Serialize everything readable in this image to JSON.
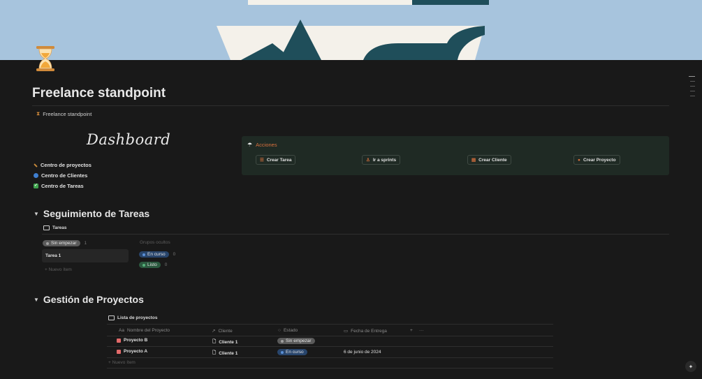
{
  "page": {
    "title": "Freelance standpoint",
    "breadcrumb": "Freelance standpoint",
    "dashboard_heading": "Dashboard"
  },
  "nav_links": [
    {
      "label": "Centro de proyectos",
      "icon": "hammer-icon",
      "color": "#c88a3a"
    },
    {
      "label": "Centro de Clientes",
      "icon": "people-icon",
      "color": "#3f7fd0"
    },
    {
      "label": "Centro de Tareas",
      "icon": "check-icon",
      "color": "#3fa34d"
    }
  ],
  "actions": {
    "title": "Acciones",
    "buttons": [
      {
        "label": "Crear Tarea",
        "icon": "list-icon"
      },
      {
        "label": "Ir a sprints",
        "icon": "runner-icon"
      },
      {
        "label": "Crear Cliente",
        "icon": "contact-icon"
      },
      {
        "label": "Crear Proyecto",
        "icon": "project-icon"
      }
    ]
  },
  "tasks_section": {
    "heading": "Seguimiento de Tareas",
    "view_tab": "Tareas",
    "groups": [
      {
        "label": "Sin empezar",
        "count": "1",
        "color": "#5a5a5a"
      },
      {
        "label": "En curso",
        "count": "0",
        "color": "#28456c"
      },
      {
        "label": "Listo",
        "count": "0",
        "color": "#2b593f"
      }
    ],
    "hidden_groups_label": "Grupos ocultos",
    "card": "Tarea 1",
    "new_item": "Nuevo ítem"
  },
  "projects_section": {
    "heading": "Gestión de Proyectos",
    "view_tab": "Lista de proyectos",
    "columns": [
      "Nombre del Proyecto",
      "Cliente",
      "Estado",
      "Fecha de Entrega"
    ],
    "rows": [
      {
        "name": "Proyecto B",
        "client": "Cliente 1",
        "status": "Sin empezar",
        "status_color": "#5a5a5a",
        "date": ""
      },
      {
        "name": "Proyecto A",
        "client": "Cliente 1",
        "status": "En curso",
        "status_color": "#28456c",
        "date": "6 de junio de 2024"
      }
    ],
    "add_column": "+",
    "more_options": "···",
    "new_item": "Nuevo ítem"
  }
}
